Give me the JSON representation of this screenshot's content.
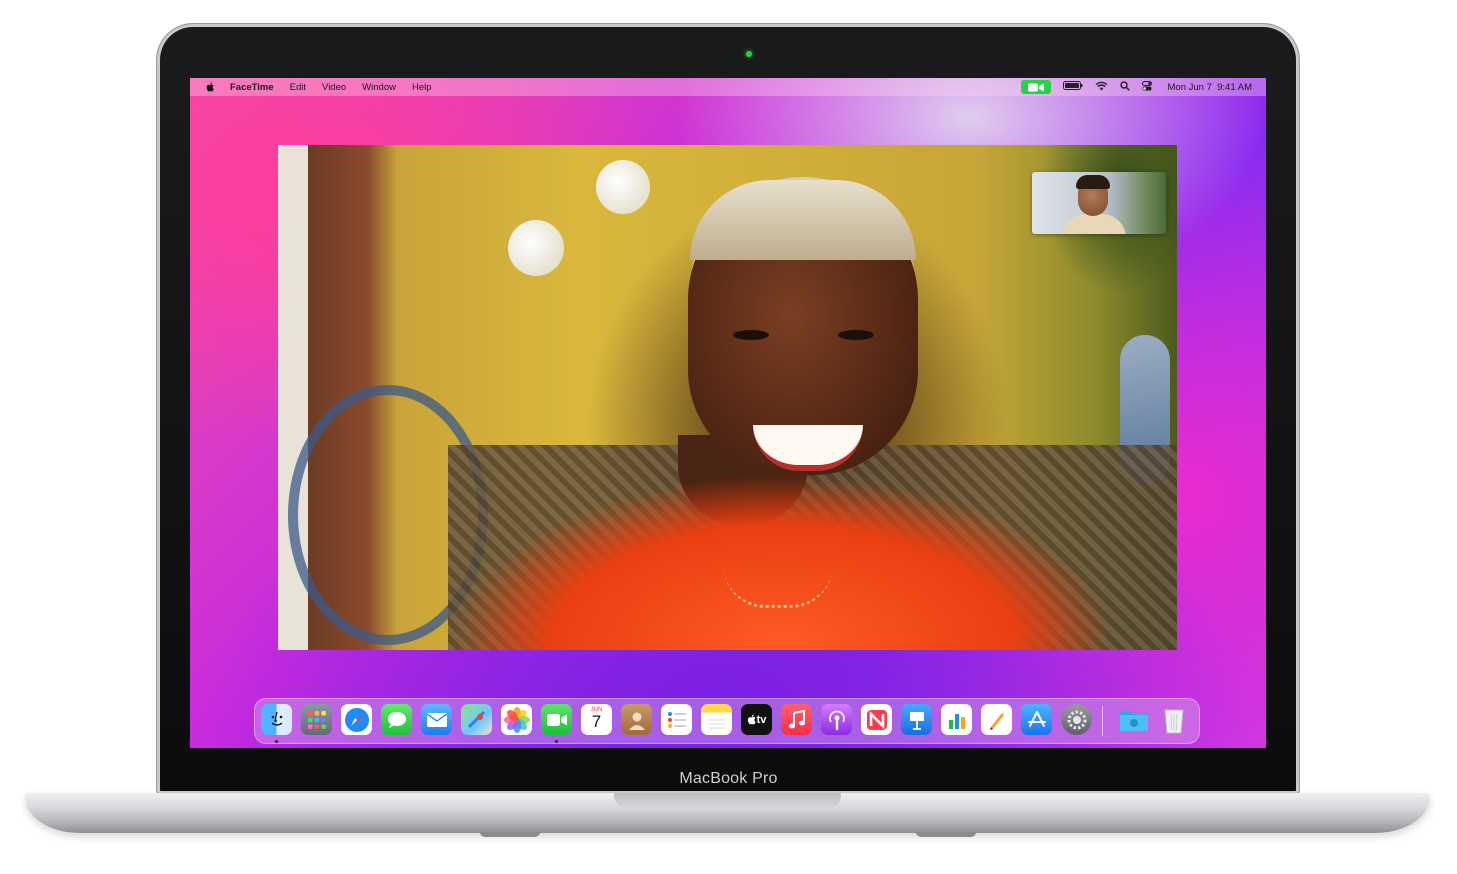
{
  "device": {
    "label": "MacBook Pro"
  },
  "menubar": {
    "apple_icon": "apple-logo-icon",
    "items": [
      "FaceTime",
      "Edit",
      "Video",
      "Window",
      "Help"
    ],
    "status": {
      "facetime_indicator": "video-camera-icon",
      "battery": "battery-icon",
      "wifi": "wifi-icon",
      "search": "search-icon",
      "control_center": "control-center-icon",
      "datetime": "Mon Jun 7  9:41 AM"
    }
  },
  "dock": {
    "items": [
      {
        "name": "finder",
        "running": true
      },
      {
        "name": "launchpad",
        "running": false
      },
      {
        "name": "safari",
        "running": false
      },
      {
        "name": "messages",
        "running": false
      },
      {
        "name": "mail",
        "running": false
      },
      {
        "name": "maps",
        "running": false
      },
      {
        "name": "photos",
        "running": false
      },
      {
        "name": "facetime",
        "running": true
      },
      {
        "name": "calendar",
        "running": false,
        "month": "JUN",
        "day": "7"
      },
      {
        "name": "contacts",
        "running": false
      },
      {
        "name": "reminders",
        "running": false
      },
      {
        "name": "notes",
        "running": false
      },
      {
        "name": "apple-tv",
        "running": false,
        "label": "tv"
      },
      {
        "name": "music",
        "running": false
      },
      {
        "name": "podcasts",
        "running": false
      },
      {
        "name": "news",
        "running": false
      },
      {
        "name": "keynote",
        "running": false
      },
      {
        "name": "numbers",
        "running": false
      },
      {
        "name": "pages",
        "running": false
      },
      {
        "name": "app-store",
        "running": false
      },
      {
        "name": "system-preferences",
        "running": false
      },
      {
        "name": "downloads-folder",
        "running": false
      },
      {
        "name": "trash",
        "running": false
      }
    ]
  }
}
